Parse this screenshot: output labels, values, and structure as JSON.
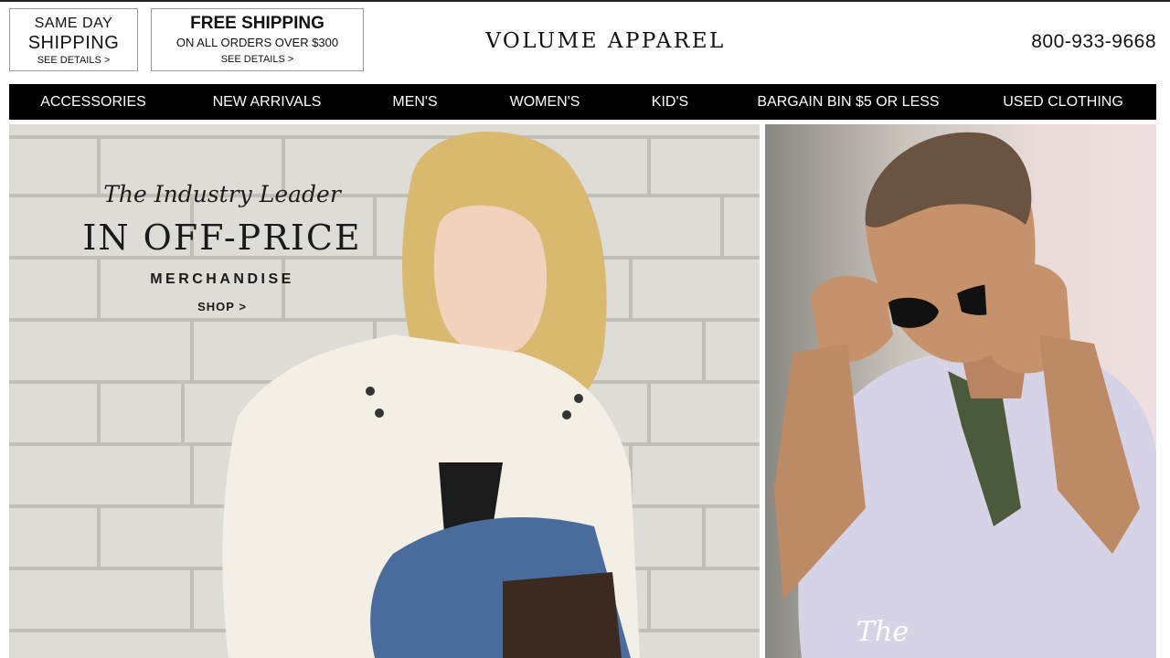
{
  "promo_same_day": {
    "line1": "SAME DAY",
    "line2": "SHIPPING",
    "details": "SEE DETAILS >"
  },
  "promo_free_shipping": {
    "line1": "FREE SHIPPING",
    "line2": "ON ALL ORDERS OVER $300",
    "details": "SEE DETAILS >"
  },
  "brand": {
    "name": "VOLUME APPAREL"
  },
  "header": {
    "phone": "800-933-9668"
  },
  "nav": {
    "items": [
      {
        "label": "ACCESSORIES"
      },
      {
        "label": "NEW ARRIVALS"
      },
      {
        "label": "MEN'S"
      },
      {
        "label": "WOMEN'S"
      },
      {
        "label": "KID'S"
      },
      {
        "label": "BARGAIN BIN $5 OR LESS"
      },
      {
        "label": "USED CLOTHING"
      }
    ]
  },
  "hero": {
    "tagline": "The Industry Leader",
    "headline": "IN OFF-PRICE",
    "subline": "MERCHANDISE",
    "cta": "SHOP >"
  },
  "hero2": {
    "title": "The"
  },
  "colors": {
    "nav_background": "#000000",
    "nav_text": "#ffffff",
    "promo_border": "#9a9a9a"
  }
}
